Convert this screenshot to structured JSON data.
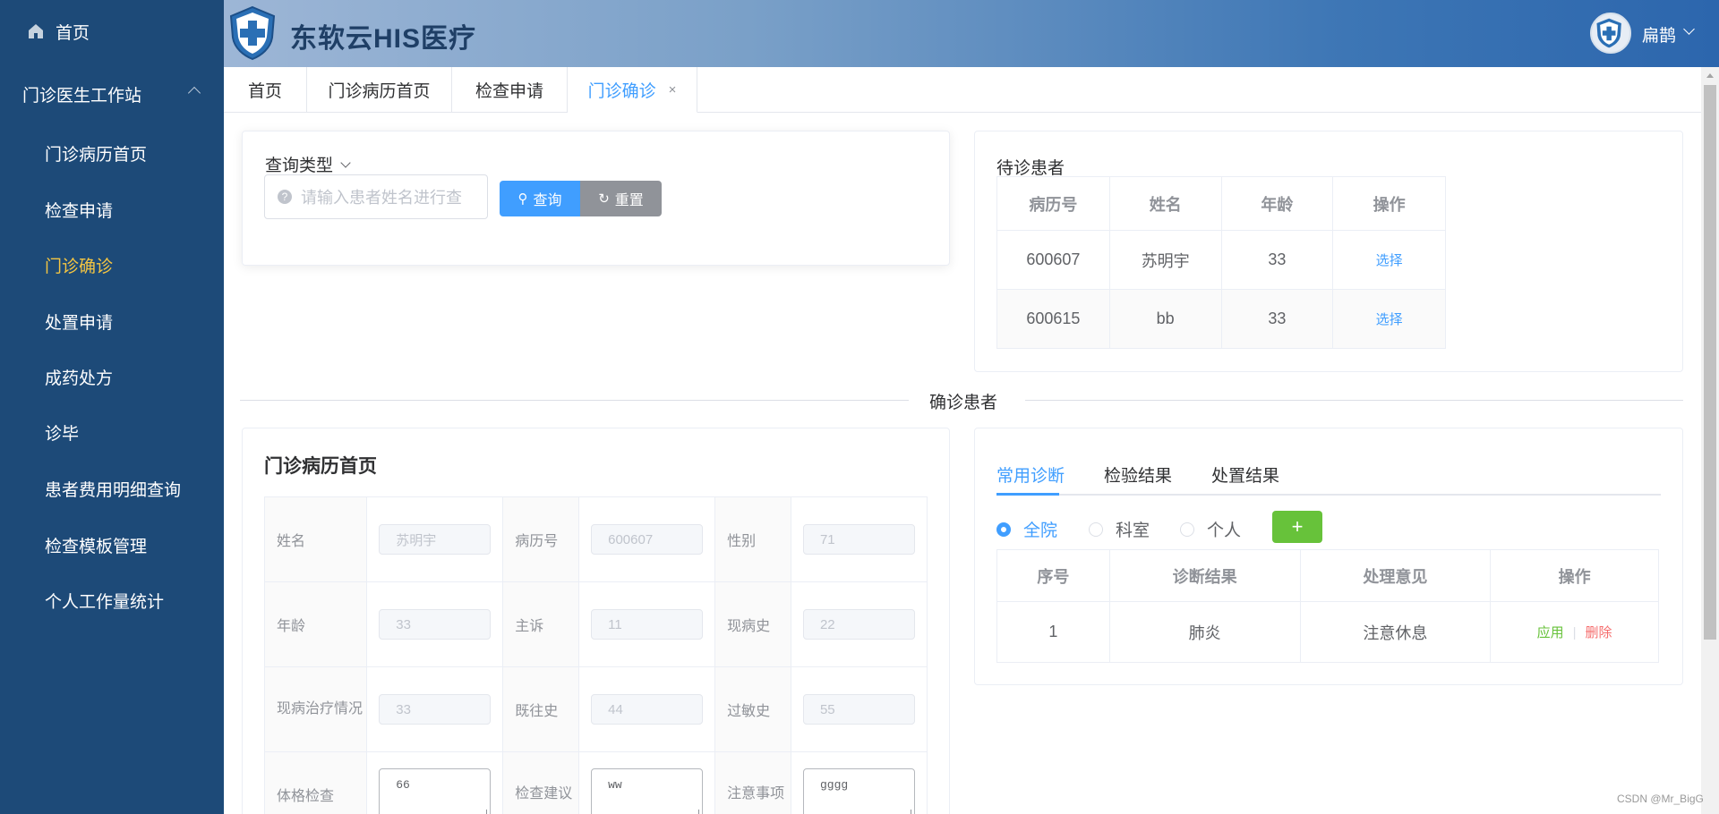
{
  "sidebar": {
    "home_label": "首页",
    "group_label": "门诊医生工作站",
    "items": [
      {
        "label": "门诊病历首页"
      },
      {
        "label": "检查申请"
      },
      {
        "label": "门诊确诊"
      },
      {
        "label": "处置申请"
      },
      {
        "label": "成药处方"
      },
      {
        "label": "诊毕"
      },
      {
        "label": "患者费用明细查询"
      },
      {
        "label": "检查模板管理"
      },
      {
        "label": "个人工作量统计"
      }
    ],
    "active_index": 2
  },
  "header": {
    "brand": "东软云HIS医疗",
    "user_name": "扁鹊"
  },
  "tabs": [
    {
      "label": "首页"
    },
    {
      "label": "门诊病历首页"
    },
    {
      "label": "检查申请"
    },
    {
      "label": "门诊确诊",
      "close": "×"
    }
  ],
  "query": {
    "type_label": "查询类型",
    "placeholder": "请输入患者姓名进行查",
    "query_button": "查询",
    "reset_button": "重置"
  },
  "waiting": {
    "title": "待诊患者",
    "columns": [
      "病历号",
      "姓名",
      "年龄",
      "操作"
    ],
    "rows": [
      {
        "id": "600607",
        "name": "苏明宇",
        "age": "33",
        "action": "选择"
      },
      {
        "id": "600615",
        "name": "bb",
        "age": "33",
        "action": "选择"
      }
    ]
  },
  "divider_label": "确诊患者",
  "record": {
    "title": "门诊病历首页",
    "rows": [
      [
        {
          "label": "姓名",
          "value": "苏明宇"
        },
        {
          "label": "病历号",
          "value": "600607"
        },
        {
          "label": "性别",
          "value": "71"
        }
      ],
      [
        {
          "label": "年龄",
          "value": "33"
        },
        {
          "label": "主诉",
          "value": "11"
        },
        {
          "label": "现病史",
          "value": "22"
        }
      ],
      [
        {
          "label": "现病治疗情况",
          "value": "33"
        },
        {
          "label": "既往史",
          "value": "44"
        },
        {
          "label": "过敏史",
          "value": "55"
        }
      ],
      [
        {
          "label": "体格检查",
          "value": "66"
        },
        {
          "label": "检查建议",
          "value": "ww"
        },
        {
          "label": "注意事项",
          "value": "gggg"
        }
      ]
    ]
  },
  "diagnosis": {
    "tabs": [
      "常用诊断",
      "检验结果",
      "处置结果"
    ],
    "scopes": [
      "全院",
      "科室",
      "个人"
    ],
    "add_label": "+",
    "columns": [
      "序号",
      "诊断结果",
      "处理意见",
      "操作"
    ],
    "rows": [
      {
        "no": "1",
        "result": "肺炎",
        "advice": "注意休息",
        "apply": "应用",
        "sep": "|",
        "delete": "删除"
      }
    ]
  },
  "watermark": "CSDN @Mr_BigG",
  "colors": {
    "sidebar": "#1d4a78",
    "active_menu": "#f4c542",
    "primary": "#409eff",
    "success": "#67c23a",
    "danger": "#f56c6c",
    "info": "#909399"
  }
}
